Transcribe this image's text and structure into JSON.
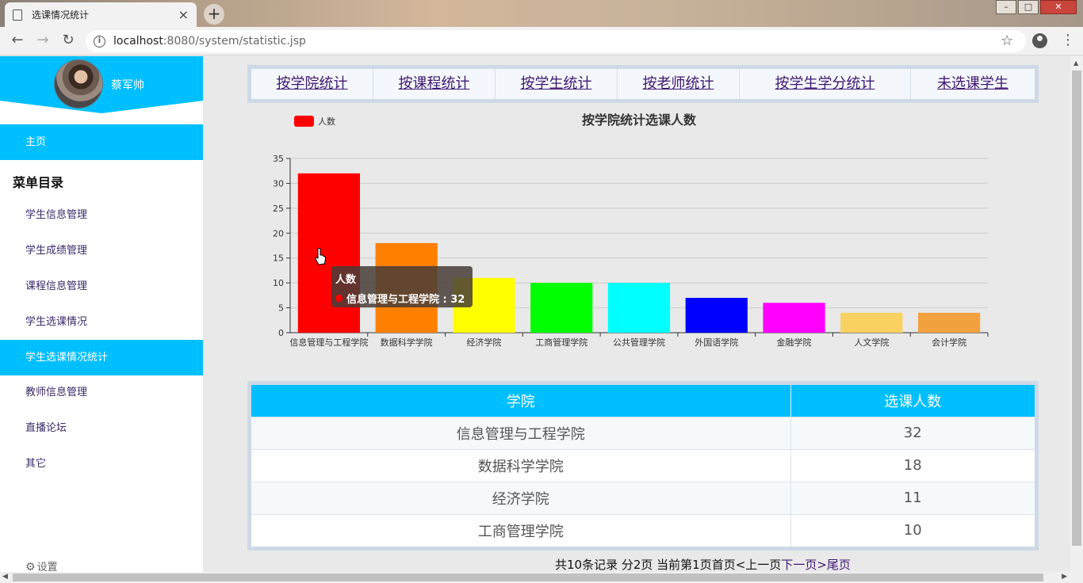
{
  "browser": {
    "tab_title": "选课情况统计",
    "tab_close": "×",
    "new_tab": "+",
    "url_host": "localhost",
    "url_path": ":8080/system/statistic.jsp",
    "window_controls": [
      "minimize-icon",
      "maximize-icon",
      "close-icon"
    ]
  },
  "sidebar": {
    "username": "蔡军帅",
    "home": "主页",
    "section_title": "菜单目录",
    "items": [
      {
        "label": "学生信息管理",
        "active": false
      },
      {
        "label": "学生成绩管理",
        "active": false
      },
      {
        "label": "课程信息管理",
        "active": false
      },
      {
        "label": "学生选课情况",
        "active": false
      },
      {
        "label": "学生选课情况统计",
        "active": true
      },
      {
        "label": "教师信息管理",
        "active": false
      },
      {
        "label": "直播论坛",
        "active": false
      },
      {
        "label": "其它",
        "active": false
      }
    ],
    "settings": "设置"
  },
  "nav_tabs": [
    "按学院统计",
    "按课程统计",
    "按学生统计",
    "按老师统计",
    "按学生学分统计",
    "未选课学生"
  ],
  "chart_data": {
    "type": "bar",
    "title": "按学院统计选课人数",
    "legend": "人数",
    "legend_position": "top-left",
    "categories": [
      "信息管理与工程学院",
      "数据科学学院",
      "经济学院",
      "工商管理学院",
      "公共管理学院",
      "外国语学院",
      "金融学院",
      "人文学院",
      "会计学院"
    ],
    "values": [
      32,
      18,
      11,
      10,
      10,
      7,
      6,
      4,
      4
    ],
    "colors": [
      "#ff0000",
      "#ff7f00",
      "#ffff00",
      "#00ff00",
      "#00ffff",
      "#0000ff",
      "#ff00ff",
      "#f9d160",
      "#f2a13f"
    ],
    "ylim": [
      0,
      35
    ],
    "yticks": [
      0,
      5,
      10,
      15,
      20,
      25,
      30,
      35
    ],
    "grid": true
  },
  "tooltip": {
    "series": "人数",
    "text": "信息管理与工程学院 : 32"
  },
  "table": {
    "headers": [
      "学院",
      "选课人数"
    ],
    "rows": [
      [
        "信息管理与工程学院",
        "32"
      ],
      [
        "数据科学学院",
        "18"
      ],
      [
        "经济学院",
        "11"
      ],
      [
        "工商管理学院",
        "10"
      ]
    ]
  },
  "pager": {
    "summary": "共10条记录 分2页 当前第1页",
    "first": "首页",
    "prev": "<上一页",
    "next": "下一页>",
    "last": "尾页"
  }
}
